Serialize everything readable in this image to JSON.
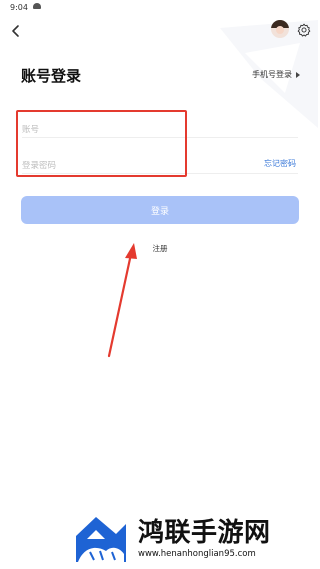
{
  "status_bar": {
    "time": "9:04"
  },
  "header": {
    "avatar_label": "用户头像"
  },
  "page": {
    "title": "账号登录",
    "alt_login_label": "手机号登录"
  },
  "form": {
    "account_placeholder": "账号",
    "password_placeholder": "登录密码",
    "forgot_label": "忘记密码",
    "login_label": "登录",
    "register_label": "注册"
  },
  "colors": {
    "primary_button": "#a9c2f8",
    "link": "#3a78d8",
    "annotation": "#e43a2f"
  },
  "watermark": {
    "name": "鸿联手游网",
    "url": "www.henanhonglian95.com"
  }
}
